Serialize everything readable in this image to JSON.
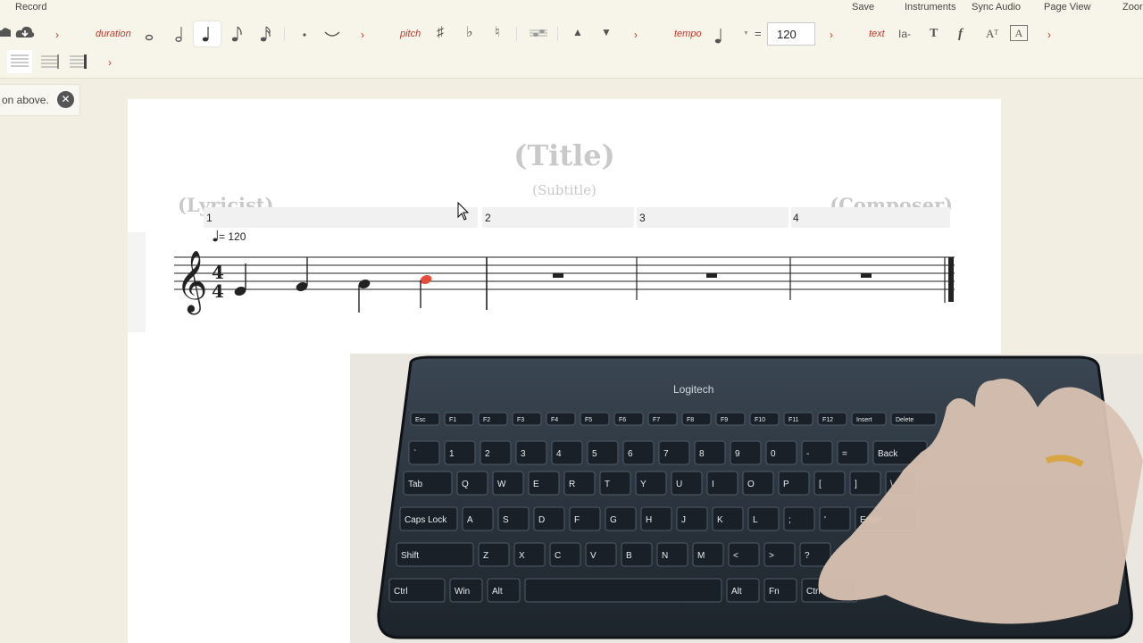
{
  "menu": {
    "record": "Record",
    "save": "Save",
    "instruments": "Instruments",
    "sync_audio": "Sync Audio",
    "page_view": "Page View",
    "zoom": "Zoor"
  },
  "toolbar": {
    "duration_label": "duration",
    "pitch_label": "pitch",
    "tempo_label": "tempo",
    "tempo_equals": "=",
    "tempo_value": "120",
    "text_label": "text",
    "text_size_icon": "Ia-",
    "text_bold_icon": "T",
    "text_dynamic_icon": "f",
    "text_superscript_icon": "Aᵀ",
    "text_box_icon": "A"
  },
  "notification": {
    "text": "on above.",
    "close_glyph": "✕"
  },
  "score": {
    "title": "(Title)",
    "subtitle": "(Subtitle)",
    "lyricist": "(Lyricist)",
    "composer": "(Composer)",
    "measure_numbers": [
      "1",
      "2",
      "3",
      "4"
    ],
    "tempo_text": "= 120",
    "time_signature_top": "4",
    "time_signature_bottom": "4",
    "selected_note_color": "#e74c3c"
  },
  "video": {
    "brand": "Logitech",
    "rows": [
      [
        "Esc",
        "F1",
        "F2",
        "F3",
        "F4",
        "F5",
        "F6",
        "F7",
        "F8",
        "F9",
        "F10",
        "F11",
        "F12",
        "Insert",
        "Delete"
      ],
      [
        "`",
        "1",
        "2",
        "3",
        "4",
        "5",
        "6",
        "7",
        "8",
        "9",
        "0",
        "-",
        "=",
        "Back"
      ],
      [
        "Tab",
        "Q",
        "W",
        "E",
        "R",
        "T",
        "Y",
        "U",
        "I",
        "O",
        "P",
        "[",
        "]",
        "\\"
      ],
      [
        "Caps Lock",
        "A",
        "S",
        "D",
        "F",
        "G",
        "H",
        "J",
        "K",
        "L",
        ";",
        "'",
        "Enter"
      ],
      [
        "Shift",
        "Z",
        "X",
        "C",
        "V",
        "B",
        "N",
        "M",
        "<",
        ">",
        "?"
      ],
      [
        "Ctrl",
        "Win",
        "Alt",
        "",
        "Alt",
        "Fn",
        "Ctrl"
      ]
    ]
  }
}
